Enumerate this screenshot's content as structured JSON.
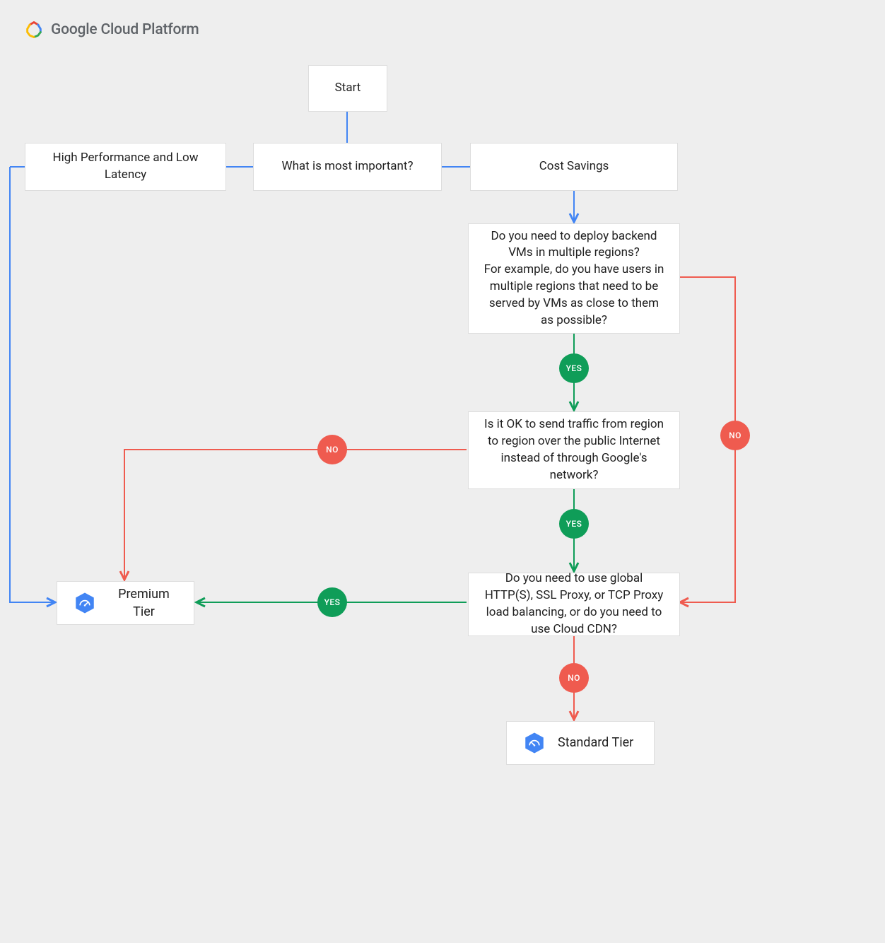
{
  "header": {
    "brand": "Google Cloud Platform"
  },
  "nodes": {
    "start": "Start",
    "question": "What is most important?",
    "perf": "High Performance and Low Latency",
    "cost": "Cost Savings",
    "q_regions": "Do you need to deploy backend VMs in multiple regions?\nFor example, do you have users in multiple regions that need to be served by VMs as close to them as possible?",
    "q_public": "Is it OK to send traffic from region to region over the public Internet instead of through Google's network?",
    "q_lb": "Do you need to use global HTTP(S), SSL Proxy, or TCP Proxy load balancing, or do you need to use Cloud CDN?",
    "premium": "Premium Tier",
    "standard": "Standard Tier"
  },
  "labels": {
    "yes": "YES",
    "no": "NO"
  },
  "colors": {
    "blue": "#4285f4",
    "green": "#0f9d58",
    "red": "#ef5b4f",
    "bg": "#eeeeee",
    "card": "#ffffff",
    "text": "#212121",
    "brand": "#5f6368"
  }
}
